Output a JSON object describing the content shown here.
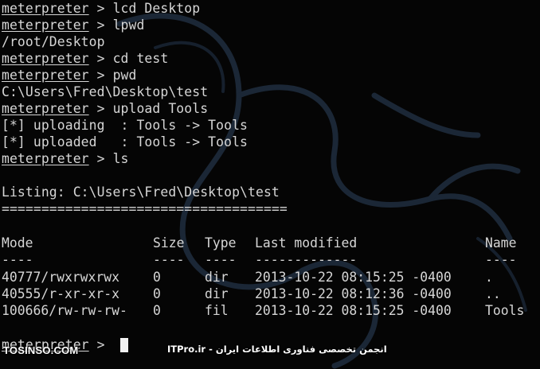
{
  "session": {
    "prompt": "meterpreter",
    "prompt_suffix": " > ",
    "lines": [
      {
        "type": "cmd",
        "command": "lcd Desktop"
      },
      {
        "type": "cmd",
        "command": "lpwd"
      },
      {
        "type": "out",
        "text": "/root/Desktop"
      },
      {
        "type": "cmd",
        "command": "cd test"
      },
      {
        "type": "cmd",
        "command": "pwd"
      },
      {
        "type": "out",
        "text": "C:\\Users\\Fred\\Desktop\\test"
      },
      {
        "type": "cmd",
        "command": "upload Tools"
      },
      {
        "type": "out",
        "text": "[*] uploading  : Tools -> Tools"
      },
      {
        "type": "out",
        "text": "[*] uploaded   : Tools -> Tools"
      },
      {
        "type": "cmd",
        "command": "ls"
      },
      {
        "type": "out",
        "text": ""
      },
      {
        "type": "out",
        "text": "Listing: C:\\Users\\Fred\\Desktop\\test"
      },
      {
        "type": "out",
        "text": "===================================="
      }
    ]
  },
  "listing": {
    "headers": {
      "mode": "Mode",
      "size": "Size",
      "type": "Type",
      "modified": "Last modified",
      "name": "Name"
    },
    "separators": {
      "mode": "----",
      "size": "----",
      "type": "----",
      "modified": "-------------",
      "name": "----"
    },
    "rows": [
      {
        "mode": "40777/rwxrwxrwx",
        "size": "0",
        "type": "dir",
        "modified": "2013-10-22 08:15:25 -0400",
        "name": "."
      },
      {
        "mode": "40555/r-xr-xr-x",
        "size": "0",
        "type": "dir",
        "modified": "2013-10-22 08:12:36 -0400",
        "name": ".."
      },
      {
        "mode": "100666/rw-rw-rw-",
        "size": "0",
        "type": "fil",
        "modified": "2013-10-22 08:15:25 -0400",
        "name": "Tools"
      }
    ]
  },
  "final_prompt": {
    "prompt": "meterpreter",
    "suffix": " > "
  },
  "watermarks": {
    "left": "TOSINSO.COM",
    "right": "ITPro.ir - انجمن تخصصی فناوری اطلاعات ایران"
  },
  "colors": {
    "background": "#050505",
    "text": "#d6d6d6",
    "dragon": "#1c2a3a",
    "cursor": "#f2f2f2"
  },
  "icons": {
    "background_logo": "kali-dragon-icon"
  }
}
